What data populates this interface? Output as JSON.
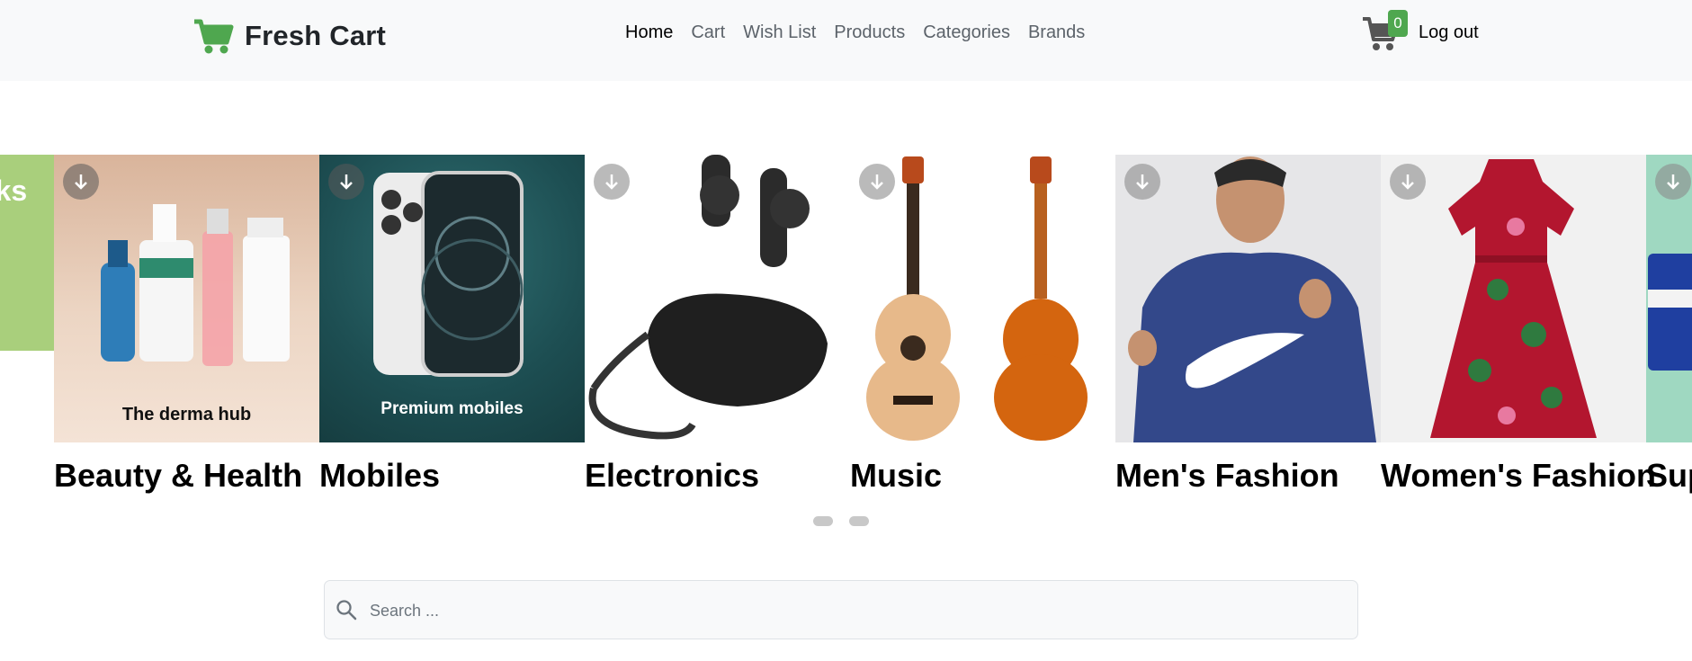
{
  "brand": {
    "name": "Fresh Cart"
  },
  "nav": {
    "links": [
      {
        "label": "Home",
        "active": true
      },
      {
        "label": "Cart"
      },
      {
        "label": "Wish List"
      },
      {
        "label": "Products"
      },
      {
        "label": "Categories"
      },
      {
        "label": "Brands"
      }
    ],
    "cart_count": "0",
    "logout_label": "Log out"
  },
  "slider": {
    "prev_slide_text": "oks",
    "categories": [
      {
        "title": "Beauty & Health",
        "image_caption": "The derma hub"
      },
      {
        "title": "Mobiles",
        "image_caption": "Premium mobiles"
      },
      {
        "title": "Electronics"
      },
      {
        "title": "Music"
      },
      {
        "title": "Men's Fashion"
      },
      {
        "title": "Women's Fashion"
      },
      {
        "title": "Sup"
      }
    ],
    "pagination_dots": 2
  },
  "search": {
    "placeholder": "Search ..."
  },
  "colors": {
    "brand": "#4fa74f",
    "navbar_bg": "#f8f9fa",
    "text": "#212529"
  }
}
